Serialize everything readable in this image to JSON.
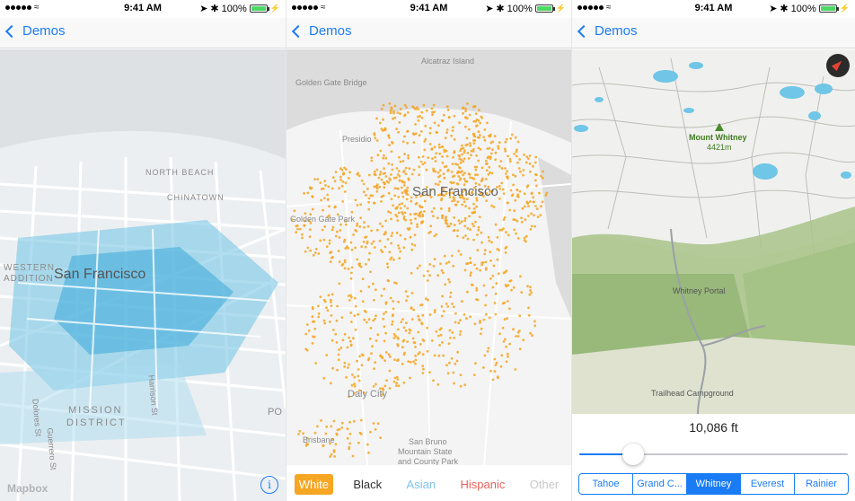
{
  "status_bar": {
    "time": "9:41 AM",
    "battery": "100%"
  },
  "panels": [
    {
      "nav": {
        "back_label": "Demos"
      },
      "map_labels": {
        "city": "San Francisco",
        "north_beach": "NORTH BEACH",
        "chinatown": "CHINATOWN",
        "western": "WESTERN",
        "addition": "ADDITION",
        "mission": "MISSION",
        "district": "DISTRICT",
        "dolores": "Dolores St",
        "guerrero": "Guerrero St",
        "harrison": "Harrison St",
        "po": "PO",
        "logo": "Mapbox"
      },
      "info_glyph": "i"
    },
    {
      "nav": {
        "back_label": "Demos"
      },
      "map_labels": {
        "alcatraz": "Alcatraz Island",
        "golden_gate_bridge": "Golden Gate Bridge",
        "presidio": "Presidio",
        "city": "San Francisco",
        "golden_gate_park": "Golden Gate Park",
        "daly_city": "Daly City",
        "brisbane": "Brisbane",
        "san_bruno": "San Bruno",
        "mountain_park": "Mountain State",
        "county_park": "and County Park"
      },
      "legend": [
        {
          "label": "White",
          "color": "#f5a623",
          "selected": true
        },
        {
          "label": "Black",
          "color": "#333333",
          "selected": false
        },
        {
          "label": "Asian",
          "color": "#7fc4e8",
          "selected": false
        },
        {
          "label": "Hispanic",
          "color": "#e8625b",
          "selected": false
        },
        {
          "label": "Other",
          "color": "#c8c8c8",
          "selected": false
        }
      ],
      "dot_color": "#f5a623"
    },
    {
      "nav": {
        "back_label": "Demos"
      },
      "map_labels": {
        "peak": "Mount Whitney",
        "peak_elev": "4421m",
        "portal": "Whitney Portal",
        "campground": "Trailhead Campground"
      },
      "elevation": "10,086 ft",
      "slider_value": 0.2,
      "segments": [
        {
          "label": "Tahoe",
          "active": false
        },
        {
          "label": "Grand C...",
          "active": false
        },
        {
          "label": "Whitney",
          "active": true
        },
        {
          "label": "Everest",
          "active": false
        },
        {
          "label": "Rainier",
          "active": false
        }
      ]
    }
  ]
}
